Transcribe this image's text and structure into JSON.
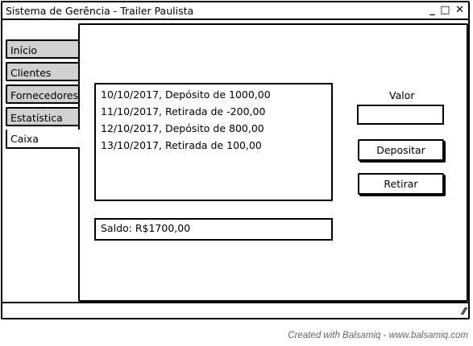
{
  "window": {
    "title": "Sistema de Gerência - Trailer Paulista",
    "controls": {
      "minimize": "_",
      "maximize": "□",
      "close": "✕"
    }
  },
  "tabs": [
    {
      "label": "Início",
      "active": false
    },
    {
      "label": "Clientes",
      "active": false
    },
    {
      "label": "Fornecedores",
      "active": false
    },
    {
      "label": "Estatística",
      "active": false
    },
    {
      "label": "Caixa",
      "active": true
    }
  ],
  "caixa": {
    "transactions": [
      "10/10/2017, Depósito de 1000,00",
      "11/10/2017, Retirada de -200,00",
      "12/10/2017, Depósito de 800,00",
      "13/10/2017, Retirada de 100,00"
    ],
    "saldo": "Saldo: R$1700,00",
    "valor_label": "Valor",
    "valor_value": "",
    "depositar_label": "Depositar",
    "retirar_label": "Retirar"
  },
  "statusbar": {
    "resize_icon": "resize-grip-icon"
  },
  "credits": "Created with Balsamiq - www.balsamiq.com"
}
